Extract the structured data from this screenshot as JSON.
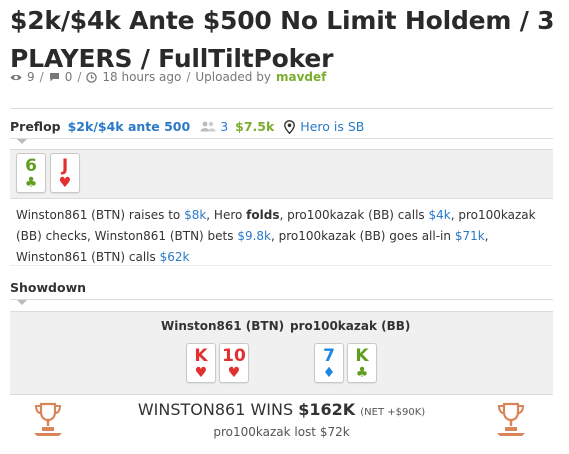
{
  "page": {
    "title": "$2k/$4k Ante $500 No Limit Holdem / 3 PLAYERS / FullTiltPoker"
  },
  "meta": {
    "views": "9",
    "comments": "0",
    "time": "18 hours ago",
    "uploaded_by_label": "Uploaded by",
    "uploader": "mavdef"
  },
  "preflop": {
    "street": "Preflop",
    "stakes": "$2k/$4k ante 500",
    "players": "3",
    "pot": "$7.5k",
    "hero_position": "Hero is SB",
    "hero_cards": [
      {
        "rank": "6",
        "suit": "♣",
        "color": "#5f9e1e"
      },
      {
        "rank": "J",
        "suit": "♥",
        "color": "#e23030"
      }
    ],
    "actions": {
      "p1": "Winston861 (BTN) raises to ",
      "a1": "$8k",
      "p2": ", Hero ",
      "fold": "folds",
      "p3": ", pro100kazak (BB) calls ",
      "a2": "$4k",
      "p4": ", pro100kazak (BB) checks, Winston861 (BTN) bets ",
      "a3": "$9.8k",
      "p5": ", pro100kazak (BB) goes all-in ",
      "a4": "$71k",
      "p6": ", Winston861 (BTN) calls ",
      "a5": "$62k"
    }
  },
  "showdown": {
    "label": "Showdown",
    "players": [
      {
        "name": "Winston861 (BTN)",
        "cards": [
          {
            "rank": "K",
            "suit": "♥",
            "color": "#e23030"
          },
          {
            "rank": "10",
            "suit": "♥",
            "color": "#e23030"
          }
        ]
      },
      {
        "name": "pro100kazak (BB)",
        "cards": [
          {
            "rank": "7",
            "suit": "♦",
            "color": "#1f87e0"
          },
          {
            "rank": "K",
            "suit": "♣",
            "color": "#5f9e1e"
          }
        ]
      }
    ]
  },
  "result": {
    "winner_text": "WINSTON861 WINS",
    "amount": "$162K",
    "net": "(NET +$90K)",
    "loser_text": "pro100kazak lost $72k"
  },
  "colors": {
    "accent_blue": "#2a7ac8",
    "accent_green": "#7cad2e",
    "trophy": "#d9855a"
  }
}
